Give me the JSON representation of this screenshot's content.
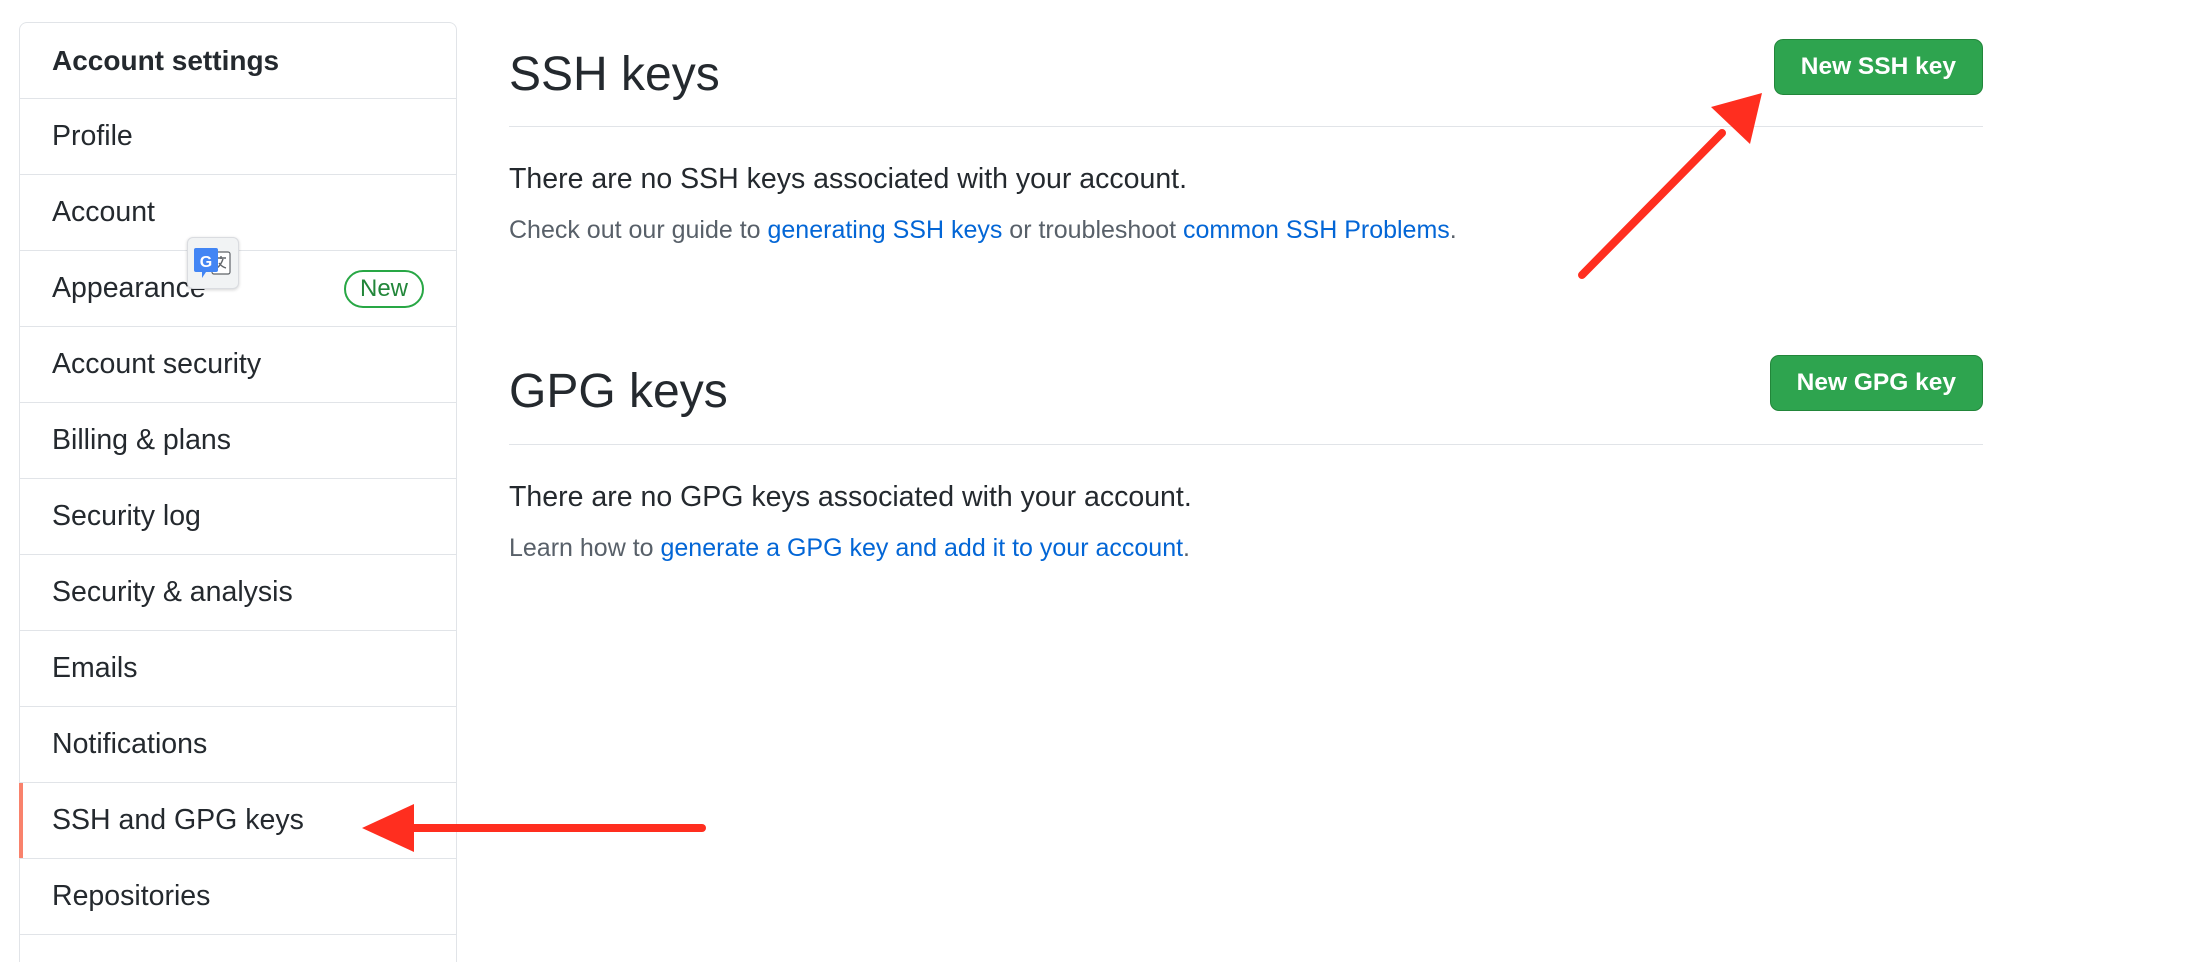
{
  "sidebar": {
    "header": "Account settings",
    "items": [
      {
        "label": "Profile"
      },
      {
        "label": "Account"
      },
      {
        "label": "Appearance",
        "badge": "New"
      },
      {
        "label": "Account security"
      },
      {
        "label": "Billing & plans"
      },
      {
        "label": "Security log"
      },
      {
        "label": "Security & analysis"
      },
      {
        "label": "Emails"
      },
      {
        "label": "Notifications"
      },
      {
        "label": "SSH and GPG keys",
        "selected": true
      },
      {
        "label": "Repositories"
      }
    ]
  },
  "ssh": {
    "title": "SSH keys",
    "button_label": "New SSH key",
    "empty_message": "There are no SSH keys associated with your account.",
    "help_prefix": "Check out our guide to ",
    "help_link1": "generating SSH keys",
    "help_middle": " or troubleshoot ",
    "help_link2": "common SSH Problems",
    "help_suffix": "."
  },
  "gpg": {
    "title": "GPG keys",
    "button_label": "New GPG key",
    "empty_message": "There are no GPG keys associated with your account.",
    "help_prefix": "Learn how to ",
    "help_link": "generate a GPG key and add it to your account",
    "help_suffix": "."
  },
  "overlay": {
    "translate_icon": "google-translate-icon",
    "translate_letter": "G",
    "annotation_color": "#ff2e1f"
  },
  "colors": {
    "button_green": "#2ea44f",
    "link_blue": "#0366d6",
    "selected_indicator": "#f9826c",
    "badge_green": "#28a745"
  }
}
